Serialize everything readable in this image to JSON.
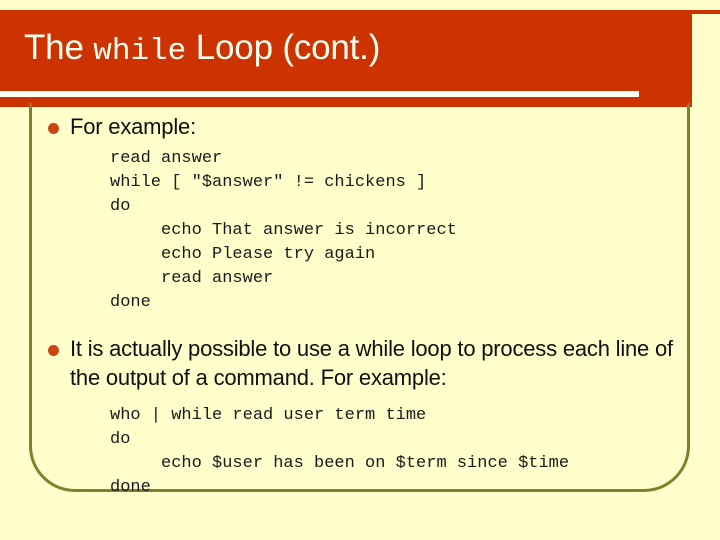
{
  "slide": {
    "background_color": "#FFFFCC",
    "banner_color": "#CC3300",
    "border_color": "#80802F",
    "bullet_color": "#CC4411",
    "title_color": "#FFFFF0"
  },
  "title": {
    "prefix": "The ",
    "keyword": "while",
    "suffix": " Loop (cont.)",
    "full": "The while Loop (cont.)"
  },
  "bullets": [
    {
      "text": "For example:",
      "code": "read answer\nwhile [ \"$answer\" != chickens ]\ndo\n     echo That answer is incorrect\n     echo Please try again\n     read answer\ndone"
    },
    {
      "text": "It is actually possible to use a while loop to process each line of the output of a command.  For example:",
      "code": "who | while read user term time\ndo\n     echo $user has been on $term since $time\ndone"
    }
  ]
}
